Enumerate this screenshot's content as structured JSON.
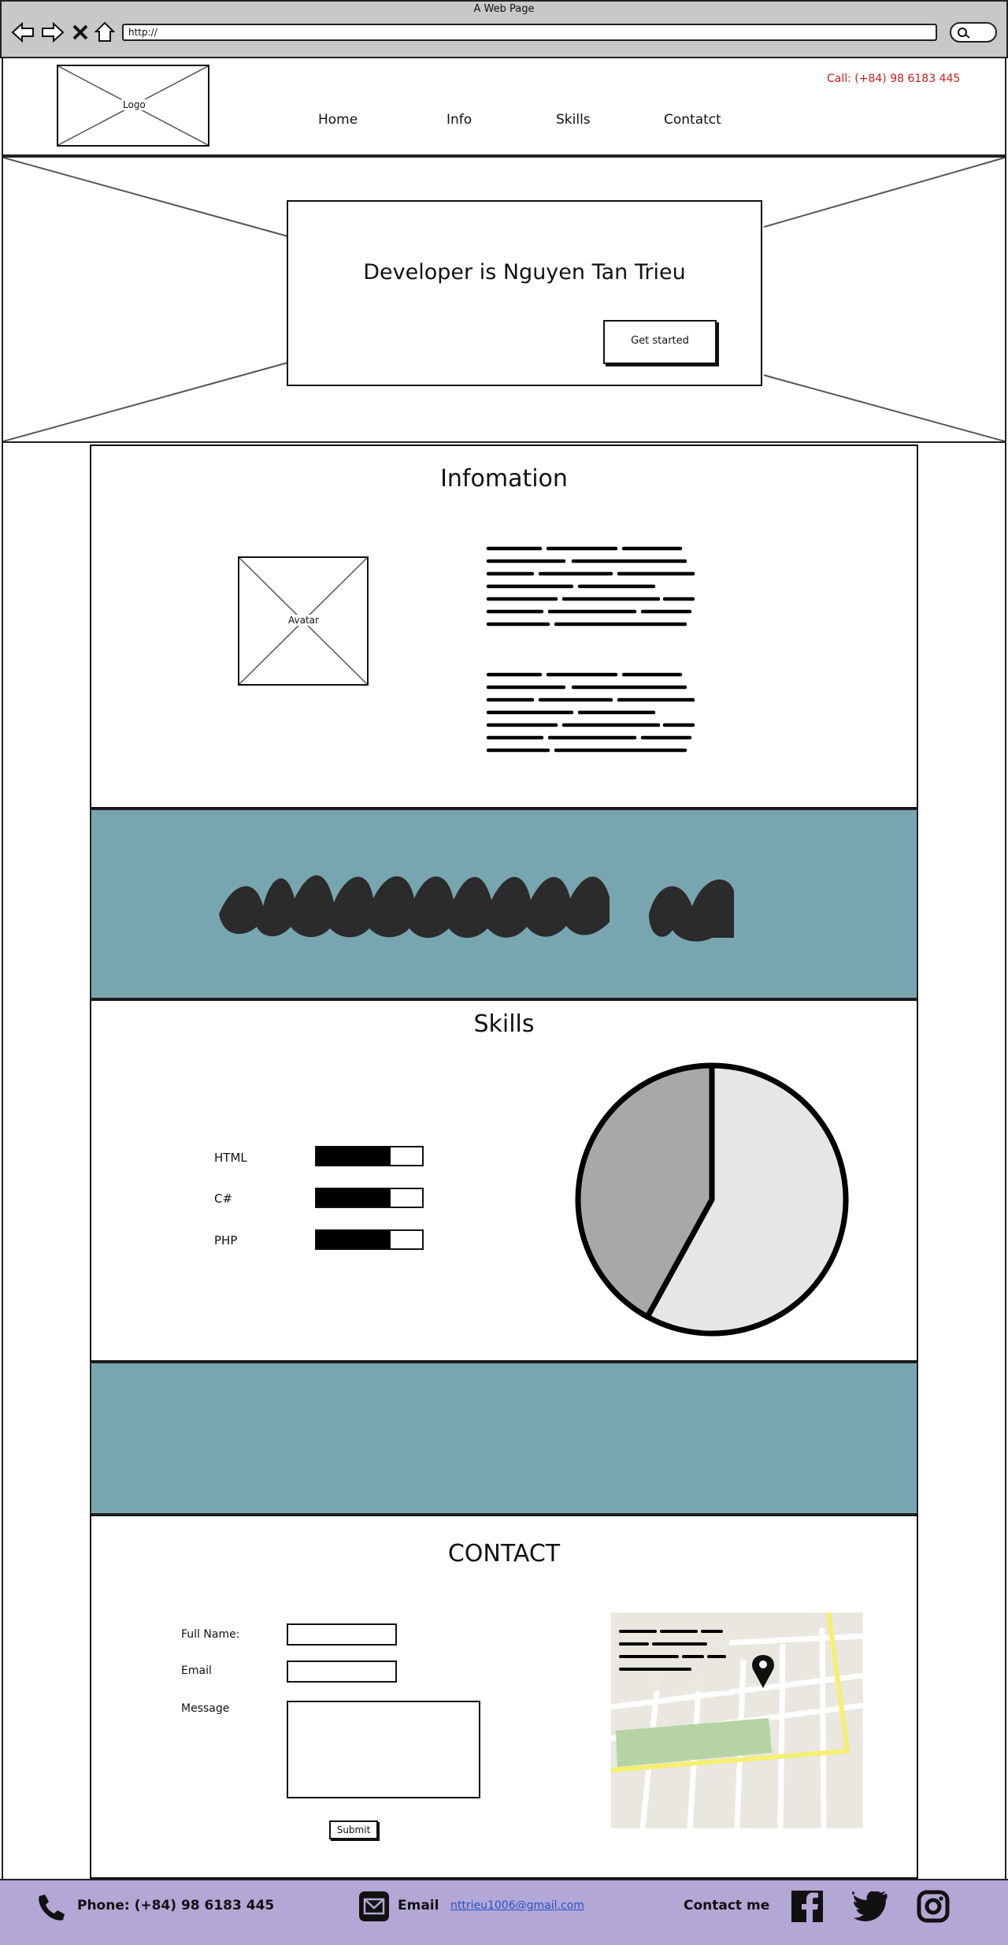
{
  "window": {
    "title": "A Web Page",
    "url": "http://"
  },
  "header": {
    "logo_label": "Logo",
    "nav": [
      "Home",
      "Info",
      "Skills",
      "Contatct"
    ],
    "call": "Call: (+84) 98 6183 445"
  },
  "hero": {
    "title": "Developer is Nguyen Tan Trieu",
    "button": "Get started"
  },
  "info": {
    "title": "Infomation",
    "avatar_label": "Avatar"
  },
  "skills": {
    "title": "Skills",
    "items": [
      {
        "name": "HTML",
        "level": 0.7
      },
      {
        "name": "C#",
        "level": 0.7
      },
      {
        "name": "PHP",
        "level": 0.7
      }
    ]
  },
  "chart_data": {
    "type": "pie",
    "slices": [
      {
        "value": 58,
        "color": "#e6e6e6"
      },
      {
        "value": 42,
        "color": "#a8a8a8"
      }
    ]
  },
  "contact": {
    "title": "CONTACT",
    "fields": [
      "Full Name:",
      "Email",
      "Message"
    ],
    "submit": "Submit"
  },
  "footer": {
    "phone": "Phone: (+84) 98 6183 445",
    "email_label": "Email",
    "email": "nttrieu1006@gmail.com",
    "contact_me": "Contact me"
  },
  "colors": {
    "banner": "#78a6b0",
    "footer": "#b3a7d6",
    "call": "#cc1d1d",
    "link": "#2754c5"
  },
  "icons": [
    "back-icon",
    "forward-icon",
    "close-icon",
    "home-icon",
    "search-icon",
    "phone-icon",
    "envelope-icon",
    "facebook-icon",
    "twitter-icon",
    "instagram-icon",
    "map-pin-icon"
  ]
}
